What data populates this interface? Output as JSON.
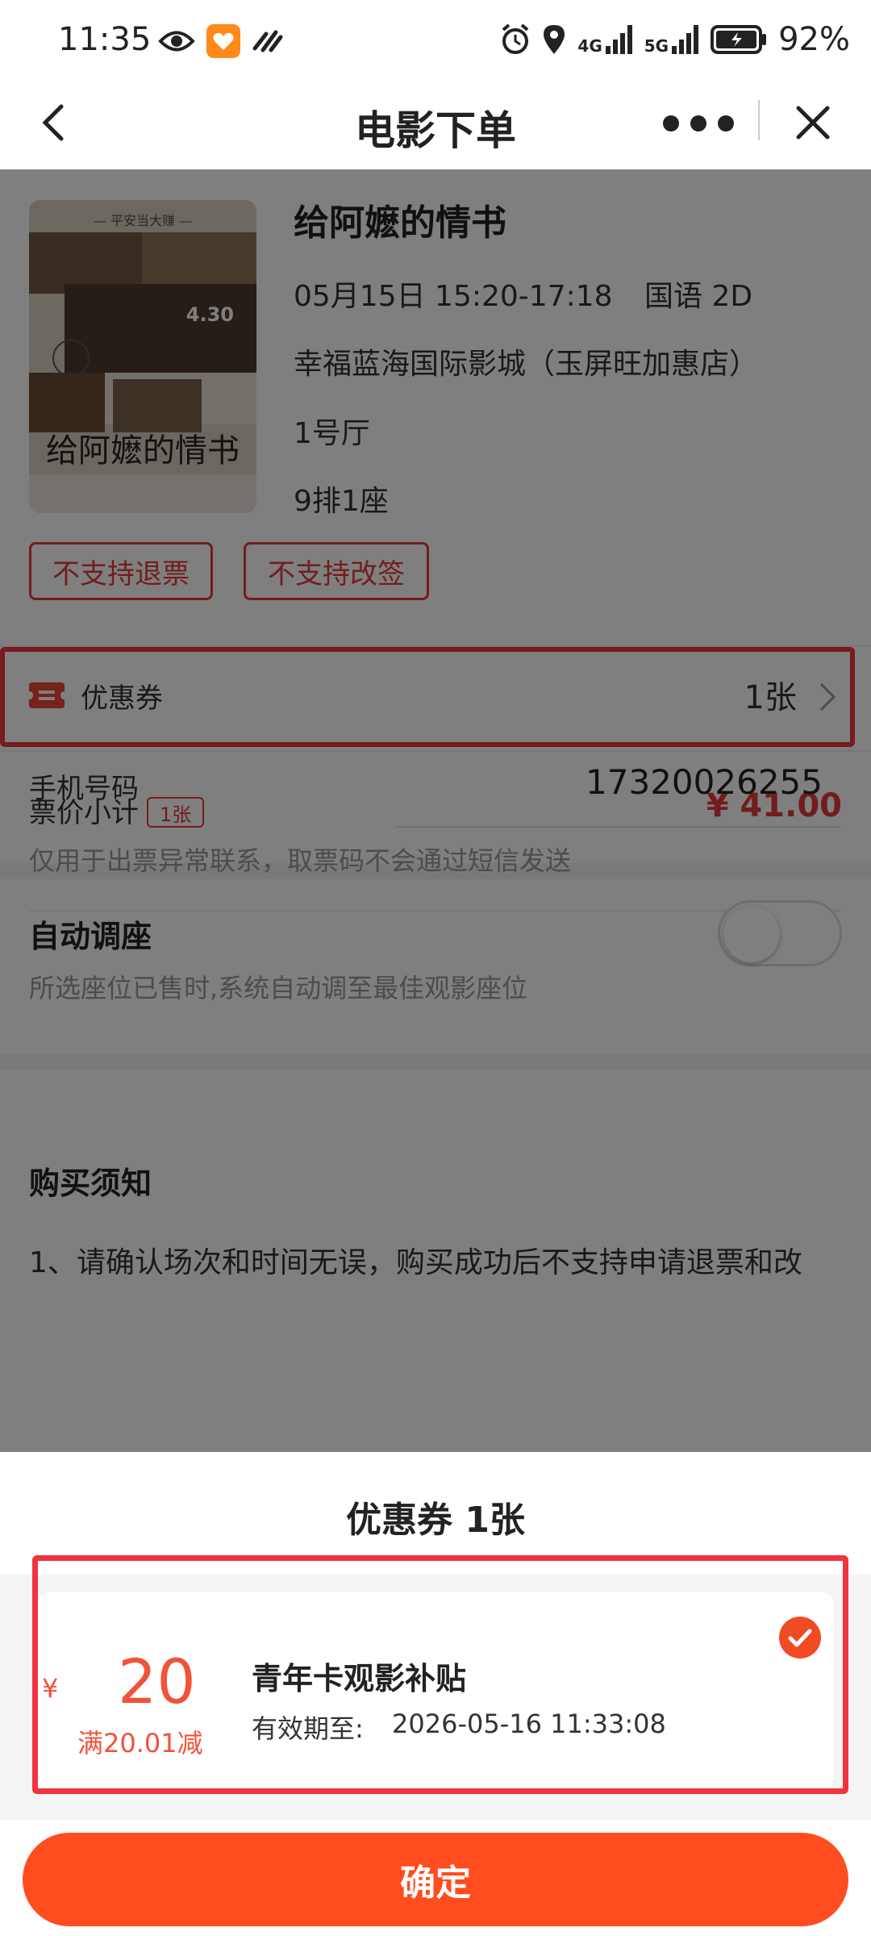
{
  "status_bar": {
    "time": "11:35",
    "battery": "92%",
    "net1": "4G",
    "net2": "5G",
    "icons": [
      "eye-icon",
      "app-heart-icon",
      "pay-icon",
      "alarm-icon",
      "location-icon",
      "signal-icon",
      "battery-icon"
    ]
  },
  "nav": {
    "title": "电影下单"
  },
  "movie": {
    "title": "给阿嬷的情书",
    "showtime": "05月15日 15:20-17:18",
    "format": "国语 2D",
    "cinema": "幸福蓝海国际影城（玉屏旺加惠店）",
    "hall": "1号厅",
    "seat": "9排1座",
    "poster_tag": "— 平安当大赚 —",
    "poster_date": "4.30",
    "poster_title": "给阿嬷的情书"
  },
  "tags": [
    "不支持退票",
    "不支持改签"
  ],
  "coupon_row": {
    "label": "优惠券",
    "count": "1张"
  },
  "price": {
    "label": "票价小计",
    "qty": "1张",
    "value": "¥ 41.00"
  },
  "phone": {
    "label": "手机号码",
    "value": "17320026255",
    "hint": "仅用于出票异常联系，取票码不会通过短信发送"
  },
  "auto_seat": {
    "title": "自动调座",
    "desc": "所选座位已售时,系统自动调至最佳观影座位",
    "enabled": false
  },
  "notice": {
    "title": "购买须知",
    "text": "1、请确认场次和时间无误，购买成功后不支持申请退票和改"
  },
  "sheet": {
    "title": "优惠券  1张",
    "coupon": {
      "currency": "¥",
      "amount": "20",
      "condition": "满20.01减",
      "name": "青年卡观影补贴",
      "expiry_label": "有效期至:",
      "expiry": "2026-05-16 11:33:08",
      "selected": true
    },
    "confirm": "确定"
  },
  "colors": {
    "accent": "#ff4d1f",
    "price_red": "#e53a3a",
    "highlight": "#f0343f"
  }
}
